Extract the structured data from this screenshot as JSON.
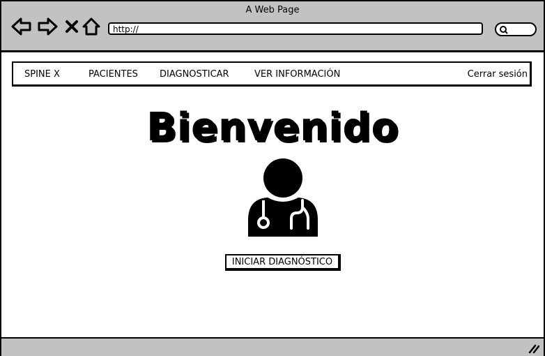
{
  "window": {
    "title": "A Web Page"
  },
  "browser": {
    "url": "http://"
  },
  "navbar": {
    "items": [
      "SPINE X",
      "PACIENTES",
      "DIAGNOSTICAR",
      "VER INFORMACIÓN"
    ],
    "logout": "Cerrar sesión"
  },
  "main": {
    "title": "Bienvenido",
    "avatar_icon": "doctor-stethoscope-icon",
    "cta_label": "INICIAR DIAGNÓSTICO"
  },
  "icons": [
    "back-arrow-icon",
    "forward-arrow-icon",
    "close-icon",
    "home-icon",
    "search-icon",
    "resize-grip-icon"
  ],
  "colors": {
    "chrome": "#c2c2c2",
    "ink": "#000000",
    "page": "#ffffff"
  }
}
